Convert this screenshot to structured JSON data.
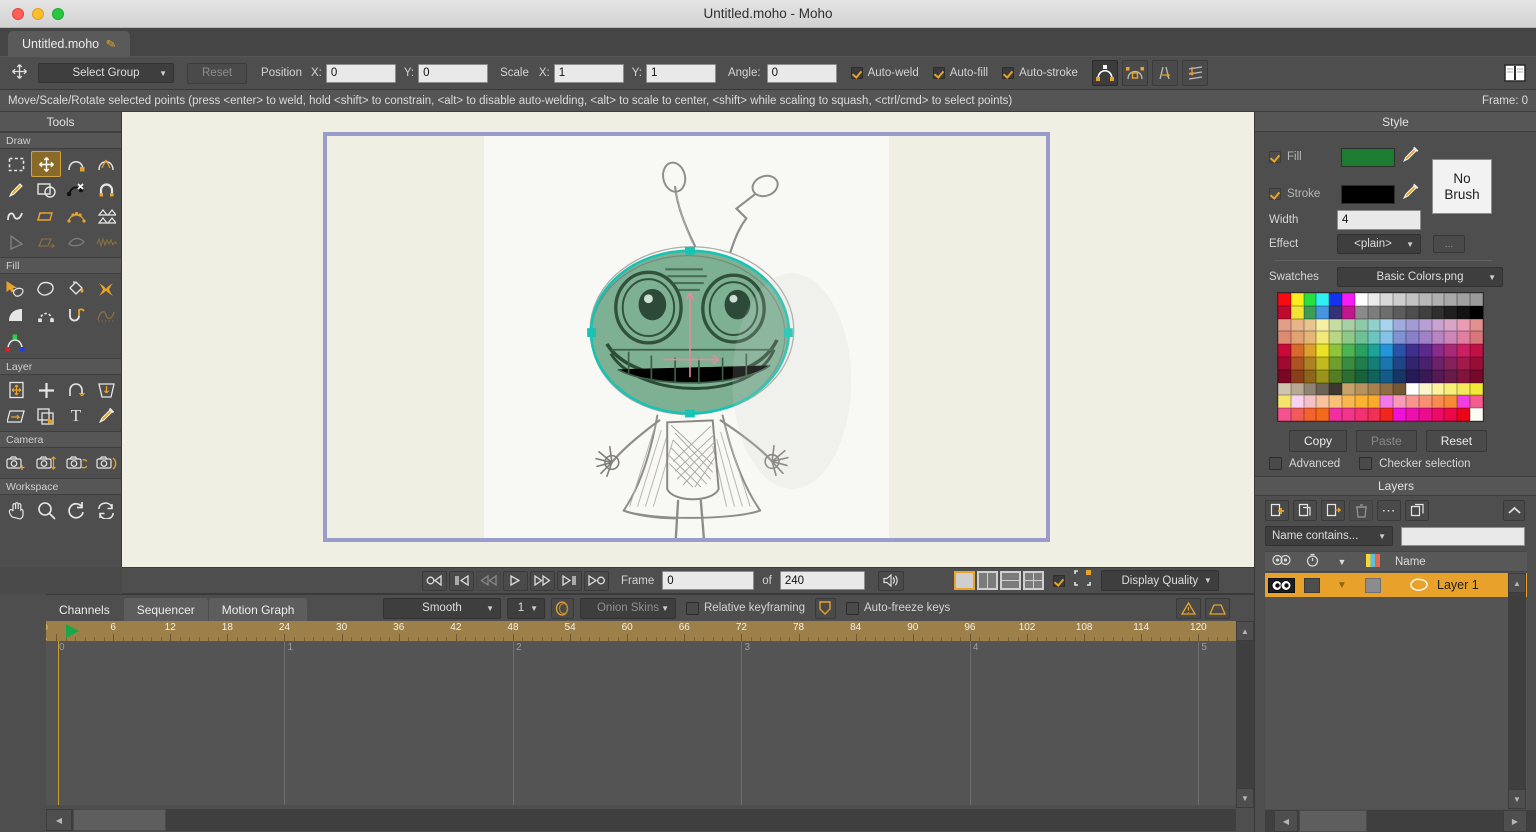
{
  "window": {
    "title": "Untitled.moho - Moho",
    "traffic_lights": [
      "close",
      "minimize",
      "zoom"
    ]
  },
  "tab": {
    "label": "Untitled.moho",
    "modified_icon": "pencil-icon"
  },
  "toolbar": {
    "tool_icon": "move-tool-icon",
    "select_group": "Select Group",
    "reset_label": "Reset",
    "position_label": "Position",
    "position_x_label": "X:",
    "position_x": "0",
    "position_y_label": "Y:",
    "position_y": "0",
    "scale_label": "Scale",
    "scale_x_label": "X:",
    "scale_x": "1",
    "scale_y_label": "Y:",
    "scale_y": "1",
    "angle_label": "Angle:",
    "angle": "0",
    "auto_weld": "Auto-weld",
    "auto_fill": "Auto-fill",
    "auto_stroke": "Auto-stroke",
    "icons": [
      "curve-peak-icon",
      "lock-curve-icon",
      "flip-path-icon",
      "push-down-icon",
      "book-icon"
    ]
  },
  "hint": {
    "text": "Move/Scale/Rotate selected points (press <enter> to weld, hold <shift> to constrain, <alt> to disable auto-welding, <alt> to scale to center, <shift> while scaling to squash, <ctrl/cmd> to select points)",
    "frame": "Frame: 0"
  },
  "tools": {
    "title": "Tools",
    "sections": [
      {
        "label": "Draw",
        "items": [
          {
            "name": "select-points-tool",
            "glyph": "▯",
            "selected": false,
            "disabled": false
          },
          {
            "name": "transform-points-tool",
            "glyph": "✥",
            "selected": true,
            "disabled": false
          },
          {
            "name": "add-point-tool",
            "glyph": "⌒",
            "selected": false,
            "disabled": false
          },
          {
            "name": "curvature-tool",
            "glyph": "⌃",
            "selected": false,
            "disabled": false
          },
          {
            "name": "freehand-tool",
            "glyph": "✎",
            "selected": false,
            "disabled": false
          },
          {
            "name": "shape-tool",
            "glyph": "▣",
            "selected": false,
            "disabled": false
          },
          {
            "name": "delete-edge-tool",
            "glyph": "✗",
            "selected": false,
            "disabled": false
          },
          {
            "name": "magnet-tool",
            "glyph": "∩",
            "selected": false,
            "disabled": false
          },
          {
            "name": "noise-tool",
            "glyph": "∿",
            "selected": false,
            "disabled": false
          },
          {
            "name": "perspective-points-tool",
            "glyph": "▱",
            "selected": false,
            "disabled": false
          },
          {
            "name": "scatter-brush-tool",
            "glyph": "⁂",
            "selected": false,
            "disabled": false
          },
          {
            "name": "shear-points-tool",
            "glyph": "◺",
            "selected": false,
            "disabled": false
          },
          {
            "name": "bend-points-tool",
            "glyph": "◁",
            "selected": false,
            "disabled": true
          },
          {
            "name": "nudge-tool",
            "glyph": "⇨",
            "selected": false,
            "disabled": true
          },
          {
            "name": "curve-profile-tool",
            "glyph": "◡",
            "selected": false,
            "disabled": true
          },
          {
            "name": "wave-tool",
            "glyph": "〰",
            "selected": false,
            "disabled": true
          }
        ]
      },
      {
        "label": "Fill",
        "items": [
          {
            "name": "select-shape-tool",
            "glyph": "➤",
            "selected": false,
            "disabled": false
          },
          {
            "name": "create-shape-tool",
            "glyph": "◯",
            "selected": false,
            "disabled": false
          },
          {
            "name": "paint-bucket-tool",
            "glyph": "⬟",
            "selected": false,
            "disabled": false
          },
          {
            "name": "delete-shape-tool",
            "glyph": "✖",
            "selected": false,
            "disabled": false
          },
          {
            "name": "gradient-tool",
            "glyph": "◤",
            "selected": false,
            "disabled": false
          },
          {
            "name": "line-width-tool",
            "glyph": "∩",
            "selected": false,
            "disabled": false
          },
          {
            "name": "stroke-exposure-tool",
            "glyph": "∪",
            "selected": false,
            "disabled": false
          },
          {
            "name": "hide-edge-tool",
            "glyph": "⌒",
            "selected": false,
            "disabled": true
          },
          {
            "name": "blend-morphs-tool",
            "glyph": "◠",
            "selected": false,
            "disabled": false
          }
        ]
      },
      {
        "label": "Layer",
        "items": [
          {
            "name": "transform-layer-tool",
            "glyph": "▤",
            "selected": false,
            "disabled": false
          },
          {
            "name": "add-layer-tool",
            "glyph": "✛",
            "selected": false,
            "disabled": false
          },
          {
            "name": "rotate-layer-z-tool",
            "glyph": "↻",
            "selected": false,
            "disabled": false
          },
          {
            "name": "shear-layer-tool",
            "glyph": "▽",
            "selected": false,
            "disabled": false
          },
          {
            "name": "follow-path-tool",
            "glyph": "▱",
            "selected": false,
            "disabled": false
          },
          {
            "name": "set-origin-tool",
            "glyph": "❐",
            "selected": false,
            "disabled": false
          },
          {
            "name": "text-tool",
            "glyph": "T",
            "selected": false,
            "disabled": false
          },
          {
            "name": "eyedropper-tool",
            "glyph": "✒",
            "selected": false,
            "disabled": false
          }
        ]
      },
      {
        "label": "Camera",
        "items": [
          {
            "name": "track-camera-tool",
            "glyph": "▣",
            "selected": false,
            "disabled": false
          },
          {
            "name": "zoom-camera-tool",
            "glyph": "▣",
            "selected": false,
            "disabled": false
          },
          {
            "name": "roll-camera-tool",
            "glyph": "▣",
            "selected": false,
            "disabled": false
          },
          {
            "name": "pan-tilt-camera-tool",
            "glyph": "▣",
            "selected": false,
            "disabled": false
          }
        ]
      },
      {
        "label": "Workspace",
        "items": [
          {
            "name": "pan-tool",
            "glyph": "✋",
            "selected": false,
            "disabled": false
          },
          {
            "name": "zoom-tool",
            "glyph": "🔍",
            "selected": false,
            "disabled": false
          },
          {
            "name": "rotate-workspace-tool",
            "glyph": "↻",
            "selected": false,
            "disabled": false
          },
          {
            "name": "reset-workspace-tool",
            "glyph": "⇄",
            "selected": false,
            "disabled": false
          }
        ]
      }
    ]
  },
  "canvas": {
    "outer_bg": "#eff0e3",
    "frame_color": "#9a9ccc",
    "paper_bg": "#f8f9f4",
    "artwork": "alien-character-sketch",
    "selection_color": "#17c4b4",
    "fill_color": "#6aab85"
  },
  "playback": {
    "buttons": [
      {
        "name": "jump-to-start-button",
        "glyph": "O◁"
      },
      {
        "name": "previous-keyframe-button",
        "glyph": "|◁"
      },
      {
        "name": "step-back-button",
        "glyph": "◁◁",
        "disabled": true
      },
      {
        "name": "play-button",
        "glyph": "▷"
      },
      {
        "name": "step-forward-button",
        "glyph": "▷▷"
      },
      {
        "name": "next-keyframe-button",
        "glyph": "▷|"
      },
      {
        "name": "jump-to-end-button",
        "glyph": "▷O"
      }
    ],
    "frame_label": "Frame",
    "frame_value": "0",
    "of_label": "of",
    "total_frames": "240",
    "audio_icon": "speaker-icon",
    "view_layouts": [
      "single-view",
      "two-column-view",
      "two-row-view",
      "quad-view"
    ],
    "selected_layout": 0,
    "checkbox_on": true,
    "bounds_icon": "bounding-box-icon",
    "display_quality": "Display Quality"
  },
  "timeline": {
    "tabs": [
      {
        "label": "Channels",
        "active": true
      },
      {
        "label": "Sequencer",
        "active": false
      },
      {
        "label": "Motion Graph",
        "active": false
      }
    ],
    "interpolation": "Smooth",
    "interp_count": "1",
    "onion_icon": "onion-skin-icon",
    "onion_skins": "Onion Skins",
    "relative_keyframing": "Relative keyframing",
    "relative_keyframing_checked": false,
    "shield_icon": "shield-icon",
    "auto_freeze_keys": "Auto-freeze keys",
    "auto_freeze_checked": false,
    "right_icons": [
      "warning-triangle-icon",
      "trapezoid-icon"
    ],
    "ruler_ticks": [
      "0",
      "6",
      "12",
      "18",
      "24",
      "30",
      "36",
      "42",
      "48",
      "54",
      "60",
      "66",
      "72",
      "78",
      "84",
      "90",
      "96",
      "102",
      "108",
      "114",
      "120"
    ],
    "second_marks": [
      "0",
      "1",
      "2",
      "3",
      "4",
      "5"
    ],
    "playhead_frame": "0"
  },
  "style": {
    "title": "Style",
    "fill_label": "Fill",
    "fill_checked": true,
    "fill_color": "#1c7c32",
    "stroke_label": "Stroke",
    "stroke_checked": true,
    "stroke_color": "#000000",
    "eyedropper_icon": "eyedropper-icon",
    "no_brush_label": "No\nBrush",
    "no_brush_line1": "No",
    "no_brush_line2": "Brush",
    "width_label": "Width",
    "width_value": "4",
    "effect_label": "Effect",
    "effect_value": "<plain>",
    "effect_more": "...",
    "swatches_label": "Swatches",
    "swatches_value": "Basic Colors.png",
    "copy_label": "Copy",
    "paste_label": "Paste",
    "paste_disabled": true,
    "reset_label": "Reset",
    "advanced_label": "Advanced",
    "advanced_checked": false,
    "checker_selection_label": "Checker selection",
    "checker_selection_checked": false,
    "swatch_colors": [
      [
        "#f60b12",
        "#faed1d",
        "#27e040",
        "#2ef0f0",
        "#1433f0",
        "#f41df4",
        "#ffffff",
        "#ebebeb",
        "#d9d9d9",
        "#cecece",
        "#c2c2c2",
        "#b8b8b8",
        "#b0b0b0",
        "#a8a8a8",
        "#a0a0a0",
        "#9a9a9a"
      ],
      [
        "#c00a2e",
        "#f2e335",
        "#3d9d55",
        "#4795de",
        "#363275",
        "#c2168c",
        "#8a8a8a",
        "#7d7d7d",
        "#6e6e6e",
        "#5c5c5c",
        "#4e4e4e",
        "#404040",
        "#2f2f2f",
        "#1f1f1f",
        "#121212",
        "#000000"
      ],
      [
        "#e0a088",
        "#e8b489",
        "#e9c493",
        "#f6f0a5",
        "#c5dda0",
        "#a8d0a4",
        "#8ec9a8",
        "#8fd2c9",
        "#a8d4ee",
        "#9fabdd",
        "#a59bd4",
        "#b79ed4",
        "#c9a3d2",
        "#d8a5c8",
        "#ea9cb4",
        "#e28f8f"
      ],
      [
        "#dd8a72",
        "#e2a26f",
        "#e6b678",
        "#f2e878",
        "#b8d684",
        "#8ec98a",
        "#6fc096",
        "#6cc6bd",
        "#84c2e8",
        "#7f92d4",
        "#8a7fc9",
        "#a080c6",
        "#b884c2",
        "#cc87b8",
        "#e07fa0",
        "#d9767c"
      ],
      [
        "#c80a36",
        "#d8692a",
        "#ddA02c",
        "#ebe226",
        "#8ec53a",
        "#4eb452",
        "#2aa060",
        "#1ca396",
        "#2296d8",
        "#2a52a8",
        "#3f2f8e",
        "#5c2a8c",
        "#8a2a8a",
        "#a82a76",
        "#cc1f62",
        "#c01046"
      ],
      [
        "#a00a2e",
        "#ad5322",
        "#b08024",
        "#c2ba1f",
        "#6fa02e",
        "#3b8c40",
        "#1f7e4a",
        "#157f76",
        "#1a76ac",
        "#204486",
        "#32246f",
        "#48226e",
        "#6c216c",
        "#86215c",
        "#a4194c",
        "#980c36"
      ],
      [
        "#7a0822",
        "#8a3f1a",
        "#8c651b",
        "#9a941a",
        "#577d24",
        "#2e6e32",
        "#18613a",
        "#10625c",
        "#145c88",
        "#183568",
        "#271b57",
        "#391a55",
        "#541a54",
        "#681a48",
        "#81143a",
        "#76092a"
      ],
      [
        "#cfc4ae",
        "#b8a994",
        "#8f8474",
        "#6b6254",
        "#3c3830",
        "#c8a268",
        "#b8915c",
        "#a8814f",
        "#8f6d42",
        "#755734",
        "#ffffff",
        "#fbf6c9",
        "#fbf39f",
        "#f8ee7a",
        "#f5e95a",
        "#f2e636"
      ],
      [
        "#f6e36a",
        "#f6d4f0",
        "#f2c2c8",
        "#f6c39c",
        "#f8c078",
        "#f9b84f",
        "#fbb233",
        "#f9ac2a",
        "#f279e8",
        "#f79ab8",
        "#f8948e",
        "#f79070",
        "#f88b52",
        "#f78a36",
        "#f03ee0",
        "#f45b8e"
      ],
      [
        "#f4528e",
        "#f35a5a",
        "#f4622e",
        "#f4691a",
        "#f22ea0",
        "#f2348a",
        "#f23270",
        "#f22f56",
        "#f2251f",
        "#f010d8",
        "#ef0eb0",
        "#ee0c8e",
        "#ed0a68",
        "#ec0848",
        "#ea0618",
        "#fdfdf5"
      ]
    ]
  },
  "layers": {
    "title": "Layers",
    "toolbar_icons": [
      {
        "name": "new-layer-icon",
        "glyph": "❐"
      },
      {
        "name": "duplicate-layer-icon",
        "glyph": "❏"
      },
      {
        "name": "layer-out-icon",
        "glyph": "❐"
      },
      {
        "name": "delete-layer-icon",
        "glyph": "🗑"
      },
      {
        "name": "more-options-icon",
        "glyph": "⋯"
      },
      {
        "name": "group-layers-icon",
        "glyph": "❏"
      }
    ],
    "collapse_icon": "chevron-up-icon",
    "filter_mode": "Name contains...",
    "filter_value": "",
    "columns": [
      {
        "name": "visibility-column",
        "glyph": "👁"
      },
      {
        "name": "timing-column",
        "glyph": "⏱"
      },
      {
        "name": "expand-column",
        "glyph": "▼"
      },
      {
        "name": "color-column",
        "glyph": "▧"
      },
      {
        "name": "name-column",
        "label": "Name"
      }
    ],
    "name_header": "Name",
    "rows": [
      {
        "name": "Layer 1",
        "visible": true,
        "type_icon": "vector-layer-icon",
        "selected": true
      }
    ]
  }
}
